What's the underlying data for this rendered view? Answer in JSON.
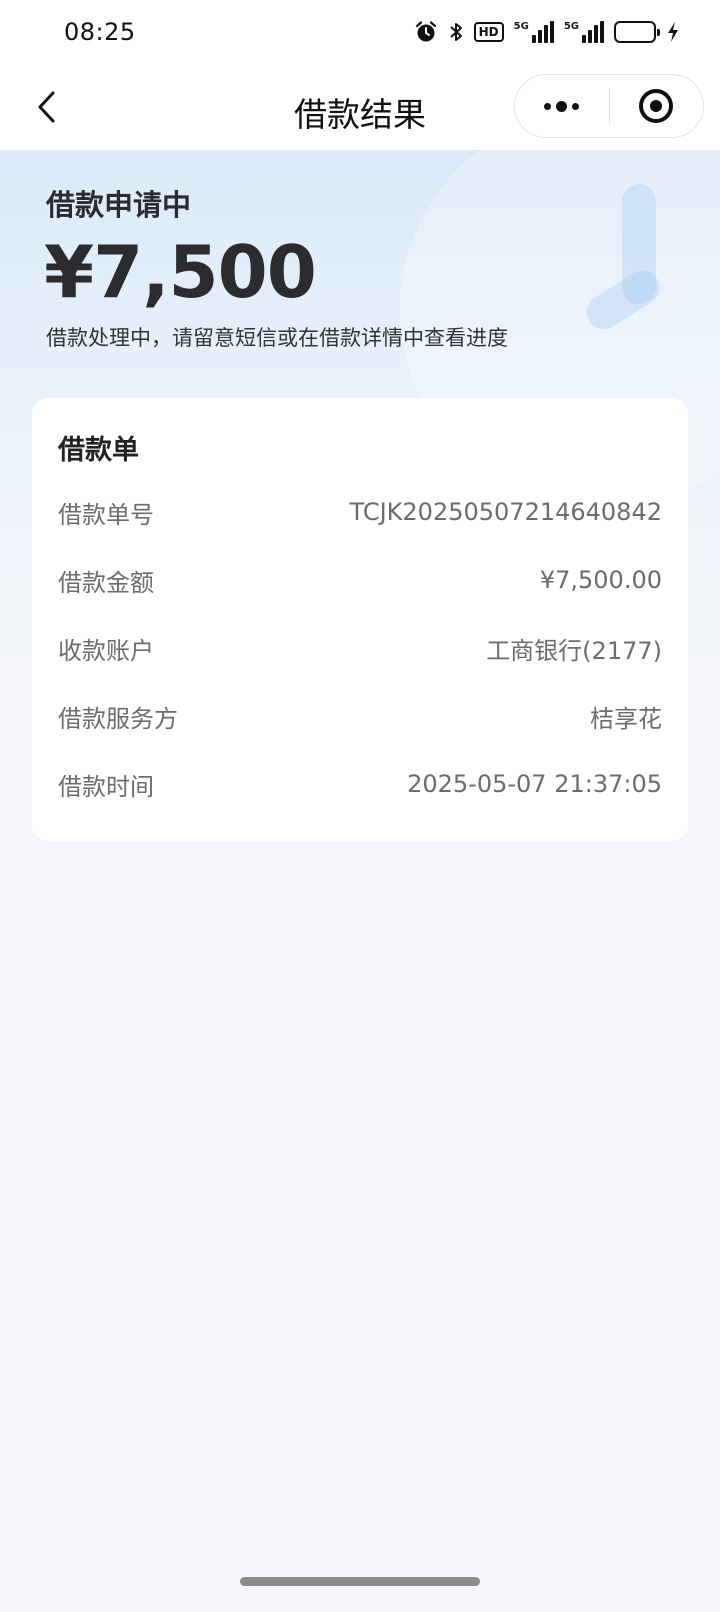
{
  "status_bar": {
    "time": "08:25",
    "icons": [
      "alarm-icon",
      "bluetooth-icon",
      "hd-voice-icon",
      "signal-5g-icon",
      "signal-5g-icon",
      "battery-icon",
      "charging-icon"
    ],
    "hd_label": "HD",
    "net1_label": "5G",
    "net2_label": "5G"
  },
  "nav": {
    "title": "借款结果",
    "back_icon": "chevron-left-icon",
    "more_icon": "more-dots-icon",
    "close_icon": "target-circle-icon"
  },
  "hero": {
    "status": "借款申请中",
    "amount": "¥7,500",
    "note": "借款处理中，请留意短信或在借款详情中查看进度"
  },
  "card": {
    "title": "借款单",
    "rows": [
      {
        "label": "借款单号",
        "value": "TCJK20250507214640842"
      },
      {
        "label": "借款金额",
        "value": "¥7,500.00"
      },
      {
        "label": "收款账户",
        "value": "工商银行(2177)"
      },
      {
        "label": "借款服务方",
        "value": "桔享花"
      },
      {
        "label": "借款时间",
        "value": "2025-05-07 21:37:05"
      }
    ]
  },
  "colors": {
    "hero_gradient_top": "#dbeaf9",
    "page_bg": "#f4f6f9",
    "text_primary": "#2b2b30",
    "text_secondary": "#6b6b70"
  }
}
